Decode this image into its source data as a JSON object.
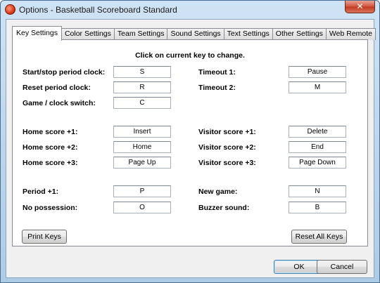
{
  "window": {
    "title": "Options - Basketball Scoreboard Standard",
    "close_glyph": "✕"
  },
  "tabs": [
    {
      "label": "Key Settings"
    },
    {
      "label": "Color Settings"
    },
    {
      "label": "Team Settings"
    },
    {
      "label": "Sound Settings"
    },
    {
      "label": "Text Settings"
    },
    {
      "label": "Other Settings"
    },
    {
      "label": "Web Remote"
    }
  ],
  "active_tab": "Key Settings",
  "instruction": "Click on current key to change.",
  "keys": {
    "start_stop": {
      "label": "Start/stop period clock:",
      "value": "S"
    },
    "reset_clock": {
      "label": "Reset period clock:",
      "value": "R"
    },
    "game_clock_switch": {
      "label": "Game / clock switch:",
      "value": "C"
    },
    "timeout1": {
      "label": "Timeout 1:",
      "value": "Pause"
    },
    "timeout2": {
      "label": "Timeout 2:",
      "value": "M"
    },
    "home1": {
      "label": "Home score +1:",
      "value": "Insert"
    },
    "home2": {
      "label": "Home score +2:",
      "value": "Home"
    },
    "home3": {
      "label": "Home score +3:",
      "value": "Page Up"
    },
    "visitor1": {
      "label": "Visitor score +1:",
      "value": "Delete"
    },
    "visitor2": {
      "label": "Visitor score +2:",
      "value": "End"
    },
    "visitor3": {
      "label": "Visitor score +3:",
      "value": "Page Down"
    },
    "period1": {
      "label": "Period +1:",
      "value": "P"
    },
    "no_possession": {
      "label": "No possession:",
      "value": "O"
    },
    "new_game": {
      "label": "New game:",
      "value": "N"
    },
    "buzzer": {
      "label": "Buzzer sound:",
      "value": "B"
    }
  },
  "buttons": {
    "print_keys": "Print Keys",
    "reset_all_keys": "Reset All Keys",
    "ok": "OK",
    "cancel": "Cancel"
  }
}
